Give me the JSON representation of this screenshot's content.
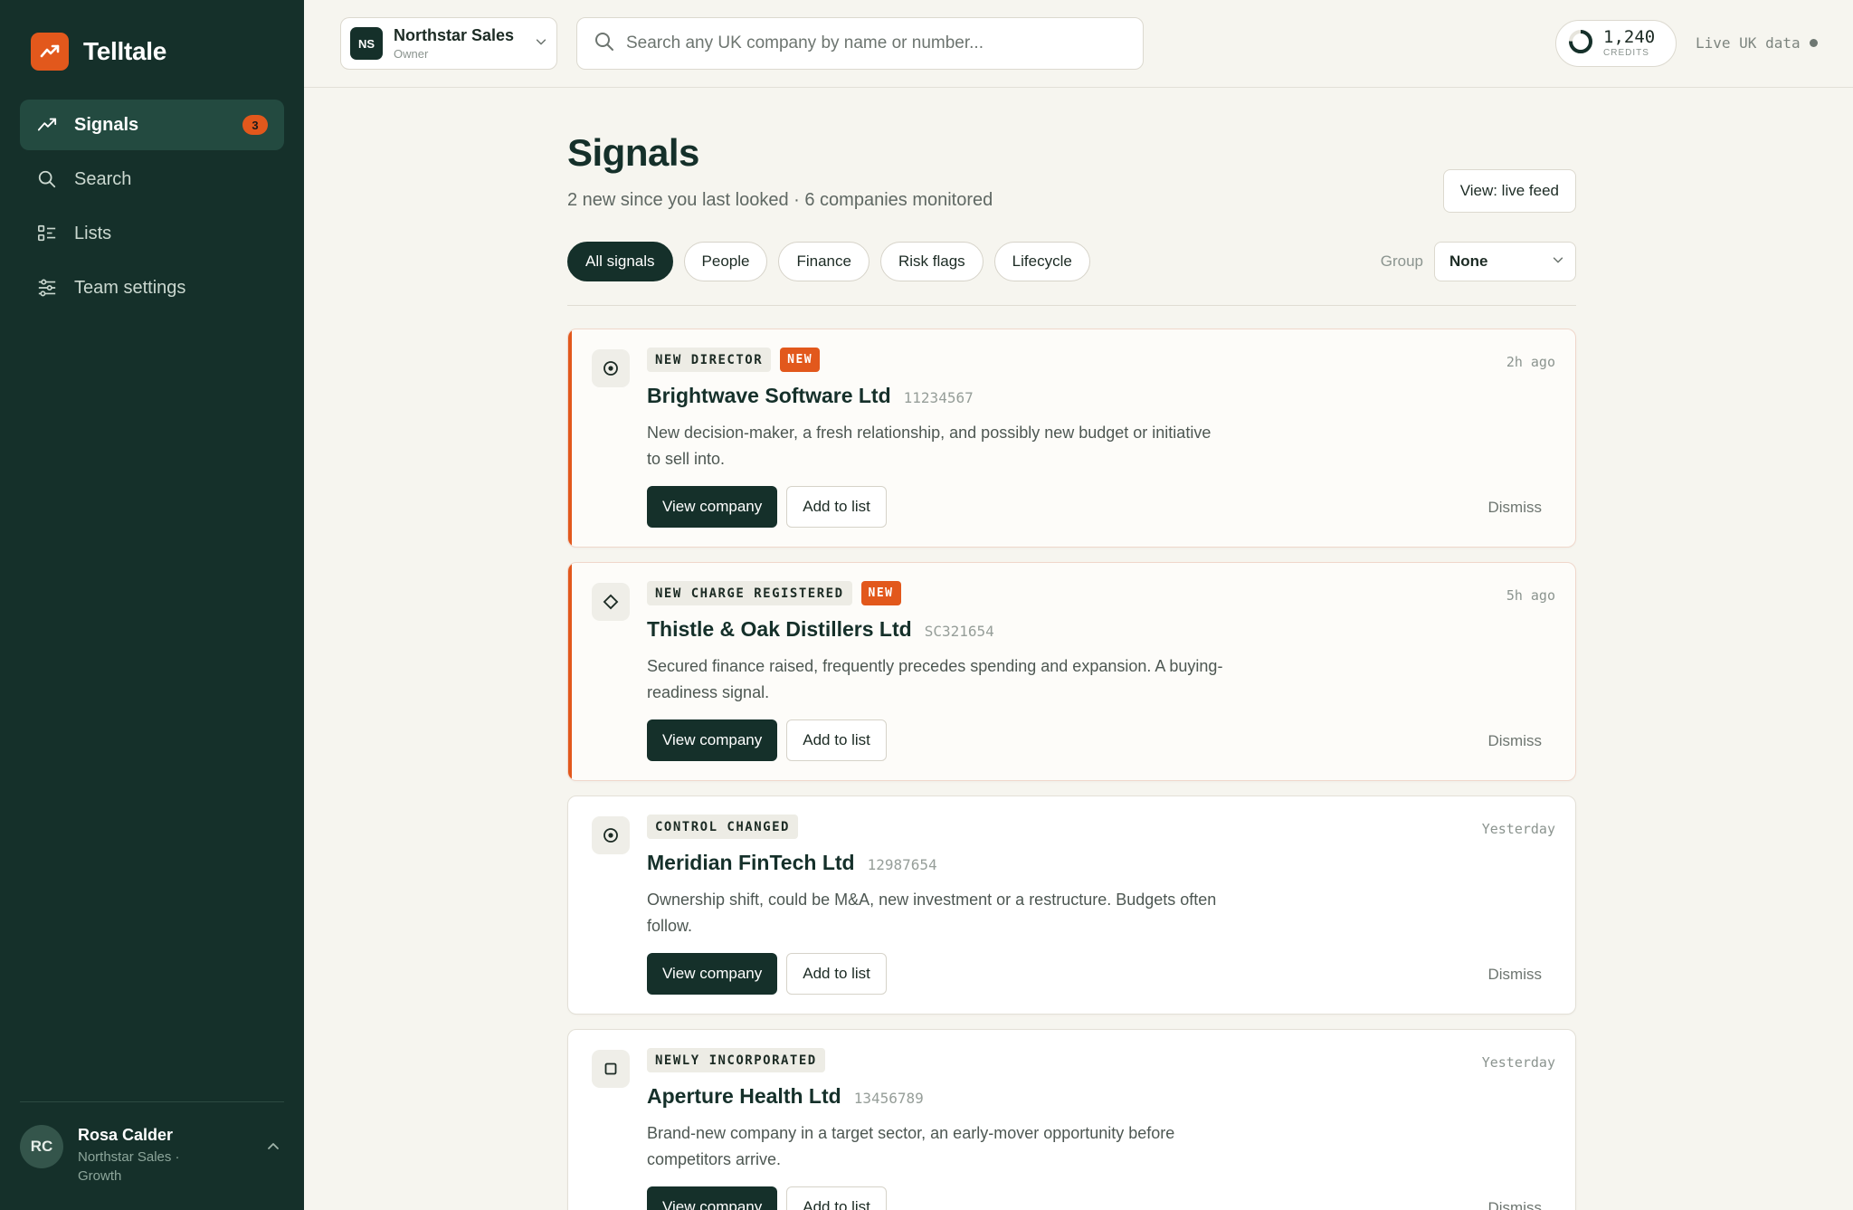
{
  "sidebar": {
    "brand": "Telltale",
    "nav": [
      {
        "label": "Signals",
        "icon": "trend-icon",
        "badge": "3",
        "active": true
      },
      {
        "label": "Search",
        "icon": "search-icon"
      },
      {
        "label": "Lists",
        "icon": "list-icon"
      },
      {
        "label": "Team settings",
        "icon": "sliders-icon"
      }
    ],
    "user": {
      "initials": "RC",
      "name": "Rosa Calder",
      "org": "Northstar Sales · Growth"
    }
  },
  "topbar": {
    "org": {
      "initials": "NS",
      "name": "Northstar Sales",
      "role": "Owner"
    },
    "search_placeholder": "Search any UK company by name or number...",
    "credits": {
      "value": "1,240",
      "label": "CREDITS"
    },
    "live_label": "Live UK data"
  },
  "main": {
    "title": "Signals",
    "subtitle": "2 new since you last looked · 6 companies monitored",
    "view_button": "View: live feed",
    "filters": [
      "All signals",
      "People",
      "Finance",
      "Risk flags",
      "Lifecycle"
    ],
    "group_label": "Group",
    "group_value": "None"
  },
  "cards": [
    {
      "type": "NEW DIRECTOR",
      "new_label": "NEW",
      "time": "2h ago",
      "company": "Brightwave Software Ltd",
      "number": "11234567",
      "desc": "New decision-maker, a fresh relationship, and possibly new budget or initiative to sell into.",
      "icon": "target-icon"
    },
    {
      "type": "NEW CHARGE REGISTERED",
      "new_label": "NEW",
      "time": "5h ago",
      "company": "Thistle & Oak Distillers Ltd",
      "number": "SC321654",
      "desc": "Secured finance raised, frequently precedes spending and expansion. A buying-readiness signal.",
      "icon": "diamond-icon"
    },
    {
      "type": "CONTROL CHANGED",
      "time": "Yesterday",
      "company": "Meridian FinTech Ltd",
      "number": "12987654",
      "desc": "Ownership shift, could be M&A, new investment or a restructure. Budgets often follow.",
      "icon": "target-icon"
    },
    {
      "type": "NEWLY INCORPORATED",
      "time": "Yesterday",
      "company": "Aperture Health Ltd",
      "number": "13456789",
      "desc": "Brand-new company in a target sector, an early-mover opportunity before competitors arrive.",
      "icon": "square-icon"
    }
  ],
  "card_actions": {
    "view": "View company",
    "add": "Add to list",
    "dismiss": "Dismiss"
  },
  "colors": {
    "sidebar": "#15302a",
    "accent": "#e2581c",
    "background": "#f6f5ef"
  }
}
